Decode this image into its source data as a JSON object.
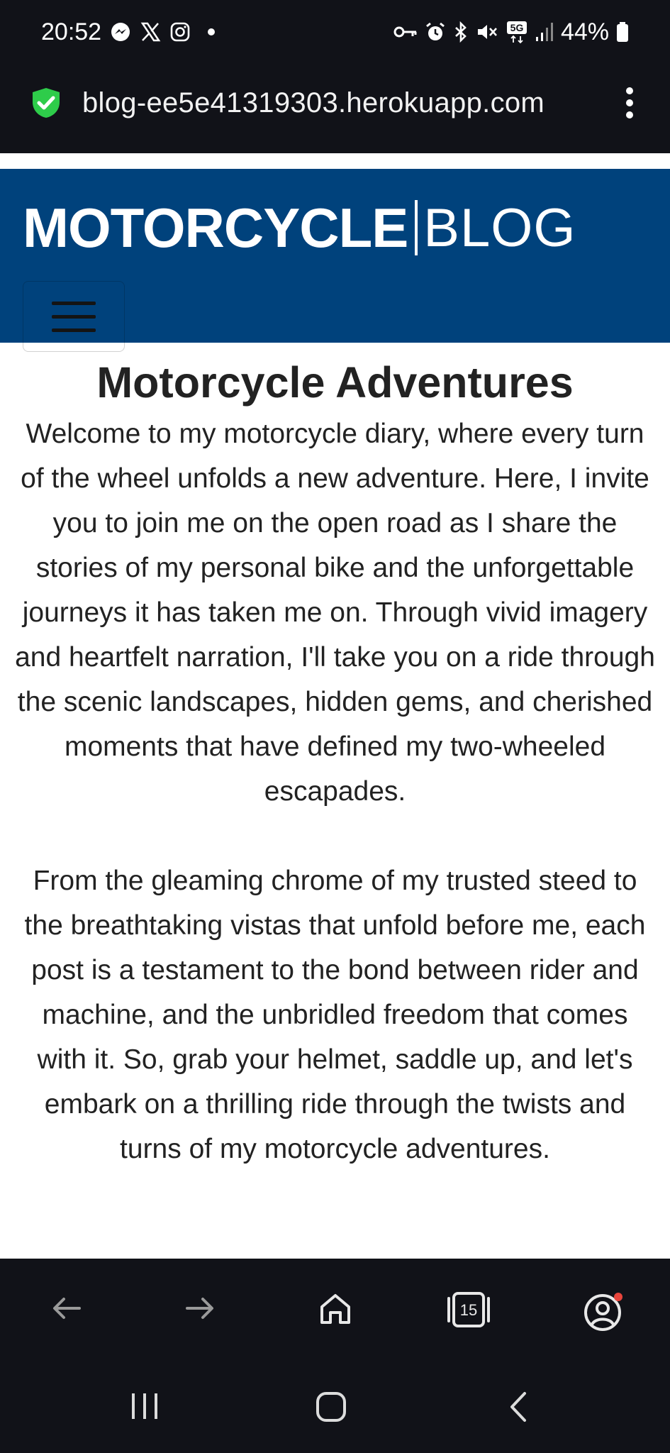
{
  "status_bar": {
    "time": "20:52",
    "left_icons": [
      "messenger-icon",
      "x-icon",
      "instagram-icon"
    ],
    "right_icons": [
      "vpn-key-icon",
      "alarm-icon",
      "bluetooth-icon",
      "mute-icon",
      "5g-icon",
      "signal-icon"
    ],
    "network": "5G",
    "battery": "44%"
  },
  "browser": {
    "url": "blog-ee5e41319303.herokuapp.com",
    "secure_icon": "shield-check-icon",
    "menu_icon": "kebab-menu-icon"
  },
  "site": {
    "brand_strong": "MOTORCYCLE",
    "brand_light": "BLOG",
    "header_color": "#00427c",
    "nav_toggle_icon": "hamburger-icon"
  },
  "article": {
    "title": "Motorcycle Adventures",
    "paragraphs": [
      "Welcome to my motorcycle diary, where every turn of the wheel unfolds a new adventure. Here, I invite you to join me on the open road as I share the stories of my personal bike and the unforgettable journeys it has taken me on. Through vivid imagery and heartfelt narration, I'll take you on a ride through the scenic landscapes, hidden gems, and cherished moments that have defined my two-wheeled escapades.",
      "From the gleaming chrome of my trusted steed to the breathtaking vistas that unfold before me, each post is a testament to the bond between rider and machine, and the unbridled freedom that comes with it. So, grab your helmet, saddle up, and let's embark on a thrilling ride through the twists and turns of my motorcycle adventures."
    ]
  },
  "browser_toolbar": {
    "tab_count": "15",
    "items": [
      "back-icon",
      "forward-icon",
      "home-icon",
      "tabs-icon",
      "account-icon"
    ],
    "notification_color": "#e8453c"
  },
  "system_nav": [
    "recents-icon",
    "home-circle-icon",
    "back-chevron-icon"
  ]
}
